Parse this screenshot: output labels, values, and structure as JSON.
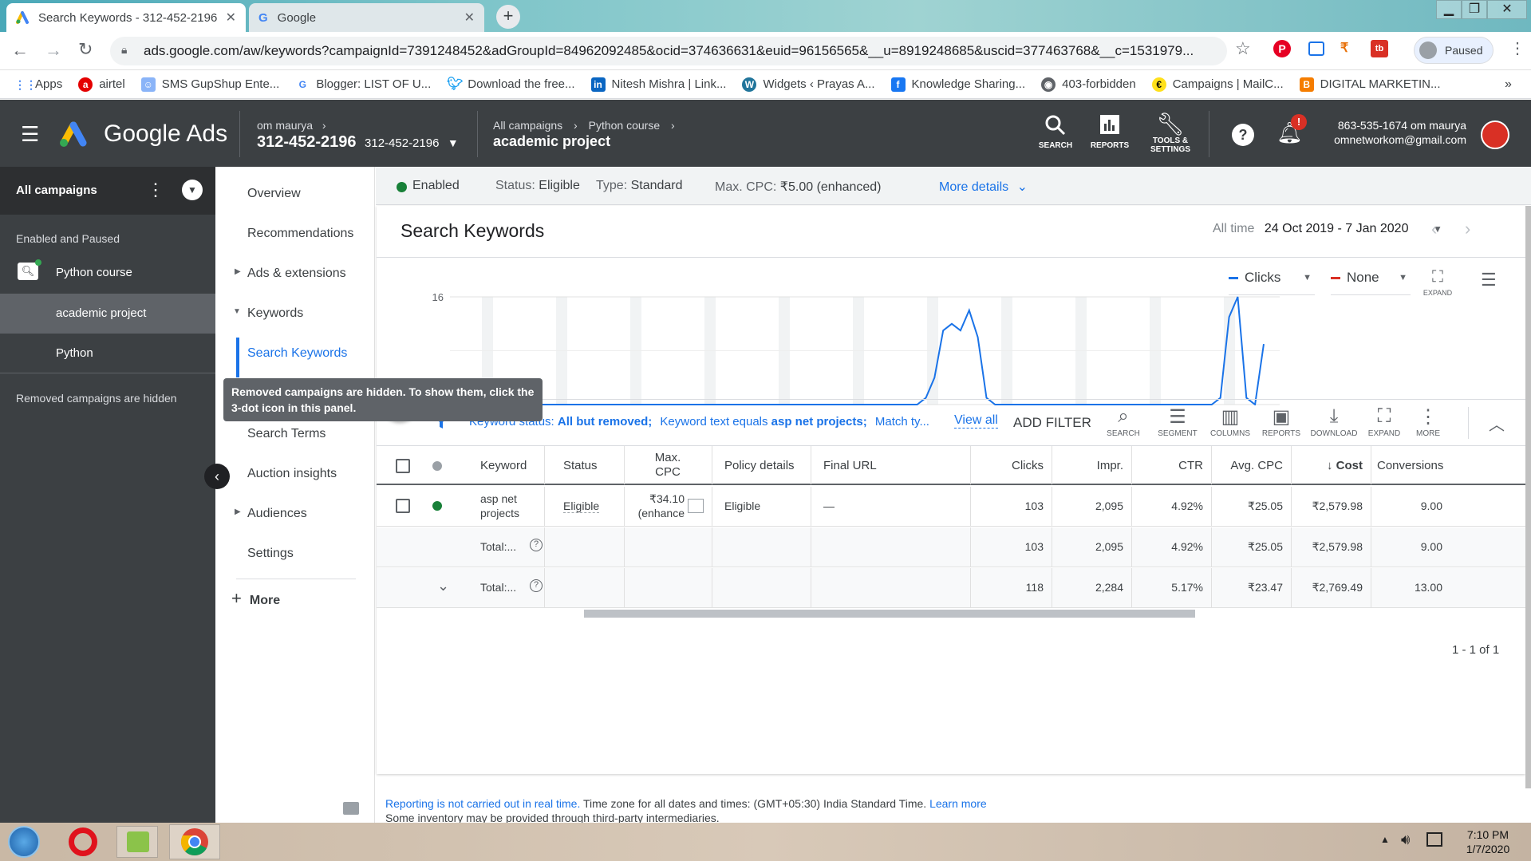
{
  "browser": {
    "tabs": [
      {
        "title": "Search Keywords - 312-452-2196",
        "close": "✕"
      },
      {
        "title": "Google",
        "close": "✕"
      }
    ],
    "new_tab": "+",
    "url": "ads.google.com/aw/keywords?campaignId=7391248452&adGroupId=84962092485&ocid=374636631&euid=96156565&__u=8919248685&uscid=377463768&__c=1531979...",
    "profile": "Paused",
    "bookmarks": [
      "Apps",
      "airtel",
      "SMS GupShup Ente...",
      "Blogger: LIST OF U...",
      "Download the free...",
      "Nitesh Mishra | Link...",
      "Widgets ‹ Prayas A...",
      "Knowledge Sharing...",
      "403-forbidden",
      "Campaigns | MailC...",
      "DIGITAL MARKETIN..."
    ],
    "bookmarks_more": "»"
  },
  "ads_header": {
    "product": "Google Ads",
    "account_name": "om maurya",
    "account_id": "312-452-2196",
    "account_id_small": "312-452-2196",
    "breadcrumb": [
      "All campaigns",
      "Python course"
    ],
    "breadcrumb_sep": ">",
    "current": "academic project",
    "tools": [
      {
        "label": "SEARCH",
        "icon": "search-icon"
      },
      {
        "label": "REPORTS",
        "icon": "reports-icon"
      },
      {
        "label": "TOOLS &",
        "label2": "SETTINGS",
        "icon": "wrench-icon"
      }
    ],
    "help": "?",
    "notif_badge": "!",
    "user_line1": "863-535-1674 om maurya",
    "user_line2": "omnetworkom@gmail.com"
  },
  "leftnav": {
    "all_campaigns": "All campaigns",
    "section": "Enabled and Paused",
    "campaign": "Python course",
    "adgroups": [
      "academic project",
      "Python"
    ],
    "removed_note": "Removed campaigns are hidden"
  },
  "tooltip": "Removed campaigns are hidden. To show them, click the 3-dot icon in this panel.",
  "pagemenu": {
    "items": [
      "Overview",
      "Recommendations",
      "Ads & extensions",
      "Keywords",
      "Search Keywords",
      "Search Terms",
      "Auction insights",
      "Audiences",
      "Settings"
    ],
    "more": "More"
  },
  "statusbar": {
    "status": "Enabled",
    "status_label": "Status:",
    "status_value": "Eligible",
    "type_label": "Type:",
    "type_value": "Standard",
    "cpc_label": "Max. CPC:",
    "cpc_value": "₹5.00 (enhanced)",
    "more": "More details"
  },
  "page": {
    "title": "Search Keywords",
    "range_label": "All time",
    "range_value": "24 Oct 2019 - 7 Jan 2020"
  },
  "chart_controls": {
    "metric1": "Clicks",
    "metric2": "None",
    "expand": "EXPAND",
    "color1": "#1a73e8",
    "color2": "#d93025"
  },
  "chart_data": {
    "type": "line",
    "x_start": "24 Oct 2019",
    "x_end": "7 Jan 2020",
    "y_ticks": [
      "16",
      "0"
    ],
    "ylim": [
      0,
      16
    ],
    "series": [
      {
        "name": "Clicks",
        "values": [
          0,
          0,
          0,
          0,
          0,
          0,
          0,
          0,
          0,
          0,
          0,
          0,
          0,
          0,
          0,
          0,
          0,
          0,
          0,
          0,
          0,
          0,
          0,
          0,
          0,
          0,
          0,
          0,
          0,
          0,
          0,
          0,
          0,
          0,
          0,
          0,
          0,
          0,
          0,
          0,
          0,
          0,
          0,
          0,
          0,
          0,
          0,
          0,
          0,
          0,
          0,
          0,
          0,
          0,
          1,
          4,
          11,
          12,
          11,
          14,
          10,
          1,
          0,
          0,
          0,
          0,
          0,
          0,
          0,
          0,
          0,
          0,
          0,
          0,
          0,
          0,
          0,
          0,
          0,
          0,
          0,
          0,
          0,
          0,
          0,
          0,
          0,
          0,
          1,
          13,
          16,
          1,
          0,
          9
        ]
      }
    ],
    "grid": true
  },
  "filterbar": {
    "filter1_label": "Keyword status:",
    "filter1_value": "All but removed;",
    "filter2_label": "Keyword text equals",
    "filter2_value": "asp net projects;",
    "filter3": "Match ty...",
    "view_all": "View all",
    "add_filter": "ADD FILTER",
    "tools": [
      "SEARCH",
      "SEGMENT",
      "COLUMNS",
      "REPORTS",
      "DOWNLOAD",
      "EXPAND",
      "MORE"
    ]
  },
  "table": {
    "headers": [
      "Keyword",
      "Status",
      "Max.",
      "CPC",
      "Policy details",
      "Final URL",
      "Clicks",
      "Impr.",
      "CTR",
      "Avg. CPC",
      "Cost",
      "Conversions"
    ],
    "row": {
      "keyword1": "asp net",
      "keyword2": "projects",
      "status": "Eligible",
      "cpc1": "₹34.10",
      "cpc2": "(enhance",
      "policy": "Eligible",
      "url": "—",
      "clicks": "103",
      "impr": "2,095",
      "ctr": "4.92%",
      "avg_cpc": "₹25.05",
      "cost": "₹2,579.98",
      "conv": "9.00"
    },
    "total1": {
      "label": "Total:...",
      "clicks": "103",
      "impr": "2,095",
      "ctr": "4.92%",
      "avg_cpc": "₹25.05",
      "cost": "₹2,579.98",
      "conv": "9.00"
    },
    "total2": {
      "label": "Total:...",
      "clicks": "118",
      "impr": "2,284",
      "ctr": "5.17%",
      "avg_cpc": "₹23.47",
      "cost": "₹2,769.49",
      "conv": "13.00"
    },
    "pagination": "1 - 1 of 1"
  },
  "footer": {
    "link1": "Reporting is not carried out in real time.",
    "text": "Time zone for all dates and times: (GMT+05:30) India Standard Time.",
    "link2": "Learn more",
    "text2": "Some inventory may be provided through third-party intermediaries."
  },
  "taskbar": {
    "time": "7:10 PM",
    "date": "1/7/2020"
  }
}
